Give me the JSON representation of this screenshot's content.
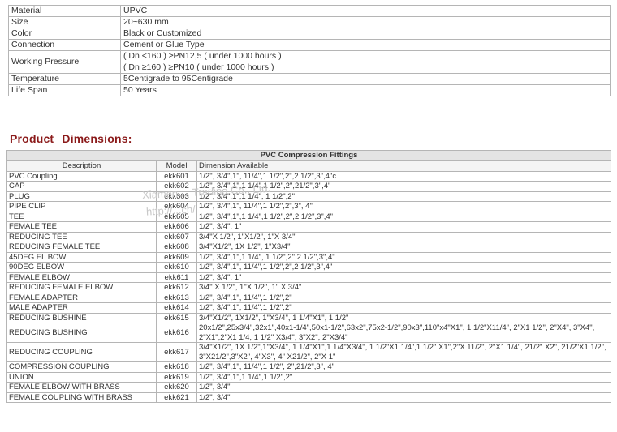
{
  "spec_rows": [
    {
      "label": "Material",
      "value": "UPVC"
    },
    {
      "label": "Size",
      "value": "20~630 mm"
    },
    {
      "label": "Color",
      "value": "Black or Customized"
    },
    {
      "label": "Connection",
      "value": "Cement or Glue Type"
    },
    {
      "label": "Working Pressure",
      "value": "( Dn <160 ) ≥PN12,5 ( under 1000 hours )",
      "value2": "( Dn ≥160 ) ≥PN10 ( under 1000 hours )"
    },
    {
      "label": "Temperature",
      "value": "5Centigrade to 95Centigrade"
    },
    {
      "label": "Life Span",
      "value": "50 Years"
    }
  ],
  "heading": "Product Dimensions:",
  "dimensions": {
    "title": "PVC Compression Fittings",
    "columns": [
      "Description",
      "Model",
      "Dimension Available"
    ],
    "rows": [
      {
        "desc": "PVC Coupling",
        "model": "ekk601",
        "dims": "1/2\", 3/4\",1\", 11/4\",1 1/2\",2\",2 1/2\",3\",4\"c"
      },
      {
        "desc": "CAP",
        "model": "ekk602",
        "dims": "1/2\", 3/4\",1\",1 1/4\",1 1/2\",2\",21/2\",3\",4\""
      },
      {
        "desc": "PLUG",
        "model": "ekk603",
        "dims": "1/2\", 3/4\",1\",1 1/4\", 1 1/2\",2\""
      },
      {
        "desc": "PIPE CLIP",
        "model": "ekk604",
        "dims": "1/2\", 3/4\",1\", 11/4\",1 1/2\",2\",3\", 4\""
      },
      {
        "desc": "TEE",
        "model": "ekk605",
        "dims": "1/2\", 3/4\",1\",1 1/4\",1 1/2\",2\",2 1/2\",3\",4\""
      },
      {
        "desc": "FEMALE TEE",
        "model": "ekk606",
        "dims": "1/2\", 3/4\", 1\""
      },
      {
        "desc": "REDUCING TEE",
        "model": "ekk607",
        "dims": "3/4\"X 1/2\", 1\"X1/2\", 1\"X 3/4\""
      },
      {
        "desc": "REDUCING FEMALE TEE",
        "model": "ekk608",
        "dims": "3/4\"X1/2\", 1X 1/2\", 1\"X3/4\""
      },
      {
        "desc": "45DEG EL BOW",
        "model": "ekk609",
        "dims": "1/2\", 3/4\",1\",1 1/4\", 1 1/2\",2\",2 1/2\",3\",4\""
      },
      {
        "desc": "90DEG ELBOW",
        "model": "ekk610",
        "dims": "1/2\", 3/4\",1\", 11/4\",1 1/2\",2\",2 1/2\",3\",4\""
      },
      {
        "desc": "FEMALE ELBOW",
        "model": "ekk611",
        "dims": "1/2\", 3/4\", 1\""
      },
      {
        "desc": "REDUCING FEMALE ELBOW",
        "model": "ekk612",
        "dims": "3/4\" X 1/2\", 1\"X 1/2\", 1\" X 3/4\""
      },
      {
        "desc": "FEMALE ADAPTER",
        "model": "ekk613",
        "dims": "1/2\", 3/4\",1\", 11/4\",1 1/2\",2\""
      },
      {
        "desc": "MALE ADAPTER",
        "model": "ekk614",
        "dims": "1/2\", 3/4\",1\", 11/4\",1 1/2\",2\""
      },
      {
        "desc": "REDUCING BUSHINE",
        "model": "ekk615",
        "dims": "3/4\"X1/2\", 1X1/2\", 1\"X3/4\", 1 1/4\"X1\", 1 1/2\""
      },
      {
        "desc": "REDUCING BUSHING",
        "model": "ekk616",
        "dims": "20x1/2\",25x3/4\",32x1\",40x1-1/4\",50x1-1/2\",63x2\",75x2-1/2\",90x3\",110\"x4\"X1\", 1 1/2\"X11/4\", 2\"X1 1/2\", 2\"X4\", 3\"X4\", 2\"X1\",2\"X1 1/4, 1 1/2\" X3/4\", 3\"X2\", 2\"X3/4\""
      },
      {
        "desc": "REDUCING COUPLING",
        "model": "ekk617",
        "dims": "3/4\"X1/2\", 1X 1/2\",1\"X3/4\", 1 1/4\"X1\",1 1/4\"X3/4\", 1 1/2\"X1 1/4\",1 1/2\" X1\",2\"X 11/2\", 2\"X1 1/4\", 21/2\" X2\", 21/2\"X1 1/2\", 3\"X21/2\",3\"X2\", 4\"X3\", 4\" X21/2\", 2\"X 1\""
      },
      {
        "desc": "COMPRESSION COUPLING",
        "model": "ekk618",
        "dims": "1/2\", 3/4\",1\", 11/4\",1 1/2\", 2\",21/2\",3\", 4\""
      },
      {
        "desc": "UNION",
        "model": "ekk619",
        "dims": "1/2\", 3/4\",1\",1 1/4\",1 1/2\",2\""
      },
      {
        "desc": "FEMALE ELBOW WITH BRASS",
        "model": "ekk620",
        "dims": "1/2\", 3/4\""
      },
      {
        "desc": "FEMALE COUPLING WITH BRASS",
        "model": "ekk621",
        "dims": "1/2\", 3/4\""
      }
    ]
  },
  "watermark": "Xiamen ... Trading Co., Ltd.",
  "watermark2": "http://...cn/"
}
